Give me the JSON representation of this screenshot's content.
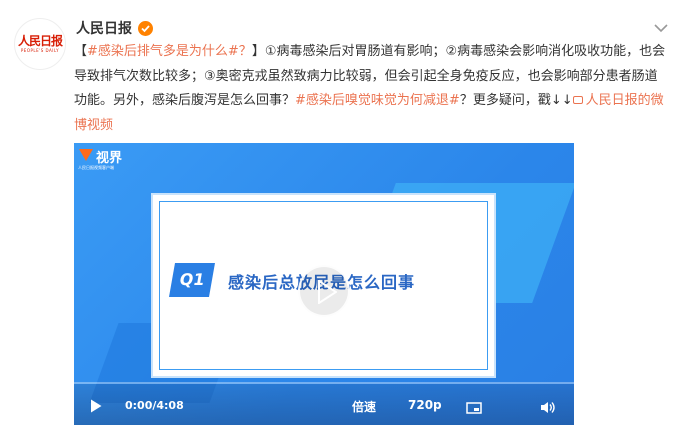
{
  "account": {
    "name": "人民日报",
    "avatar_logo": "人民日报",
    "avatar_sub": "PEOPLE'S DAILY"
  },
  "post": {
    "bracket_open": "【",
    "topic_tag": "#感染后排气多是为什么#？",
    "bracket_close": "】",
    "body_1": "①病毒感染后对胃肠道有影响；②病毒感染会影响消化吸收功能，也会导致排气次数比较多；③奥密克戎虽然致病力比较弱，但会引起全身免疫反应，也会影响部分患者肠道功能。另外，感染后腹泻是怎么回事？",
    "tag_2": "#感染后嗅觉味觉为何减退#",
    "body_2": "？更多疑问，戳↓↓",
    "video_link": "人民日报的微博视频"
  },
  "video": {
    "brand_name": "视界",
    "brand_sub": "人民日报视频客户端",
    "q_label": "Q1",
    "question": "感染后总放屁是怎么回事",
    "time": "0/00/4:08",
    "time_display": "0:00/4:08",
    "speed_label": "倍速",
    "quality_label": "720p"
  },
  "icons": {
    "verified": "verified-badge-icon",
    "more": "chevron-down-icon",
    "play": "play-icon",
    "pip": "picture-in-picture-icon",
    "volume": "volume-icon"
  },
  "colors": {
    "accent": "#eb7350",
    "verified": "#ff8200",
    "brand_red": "#d81e06",
    "video_blue": "#2d8ff0"
  }
}
